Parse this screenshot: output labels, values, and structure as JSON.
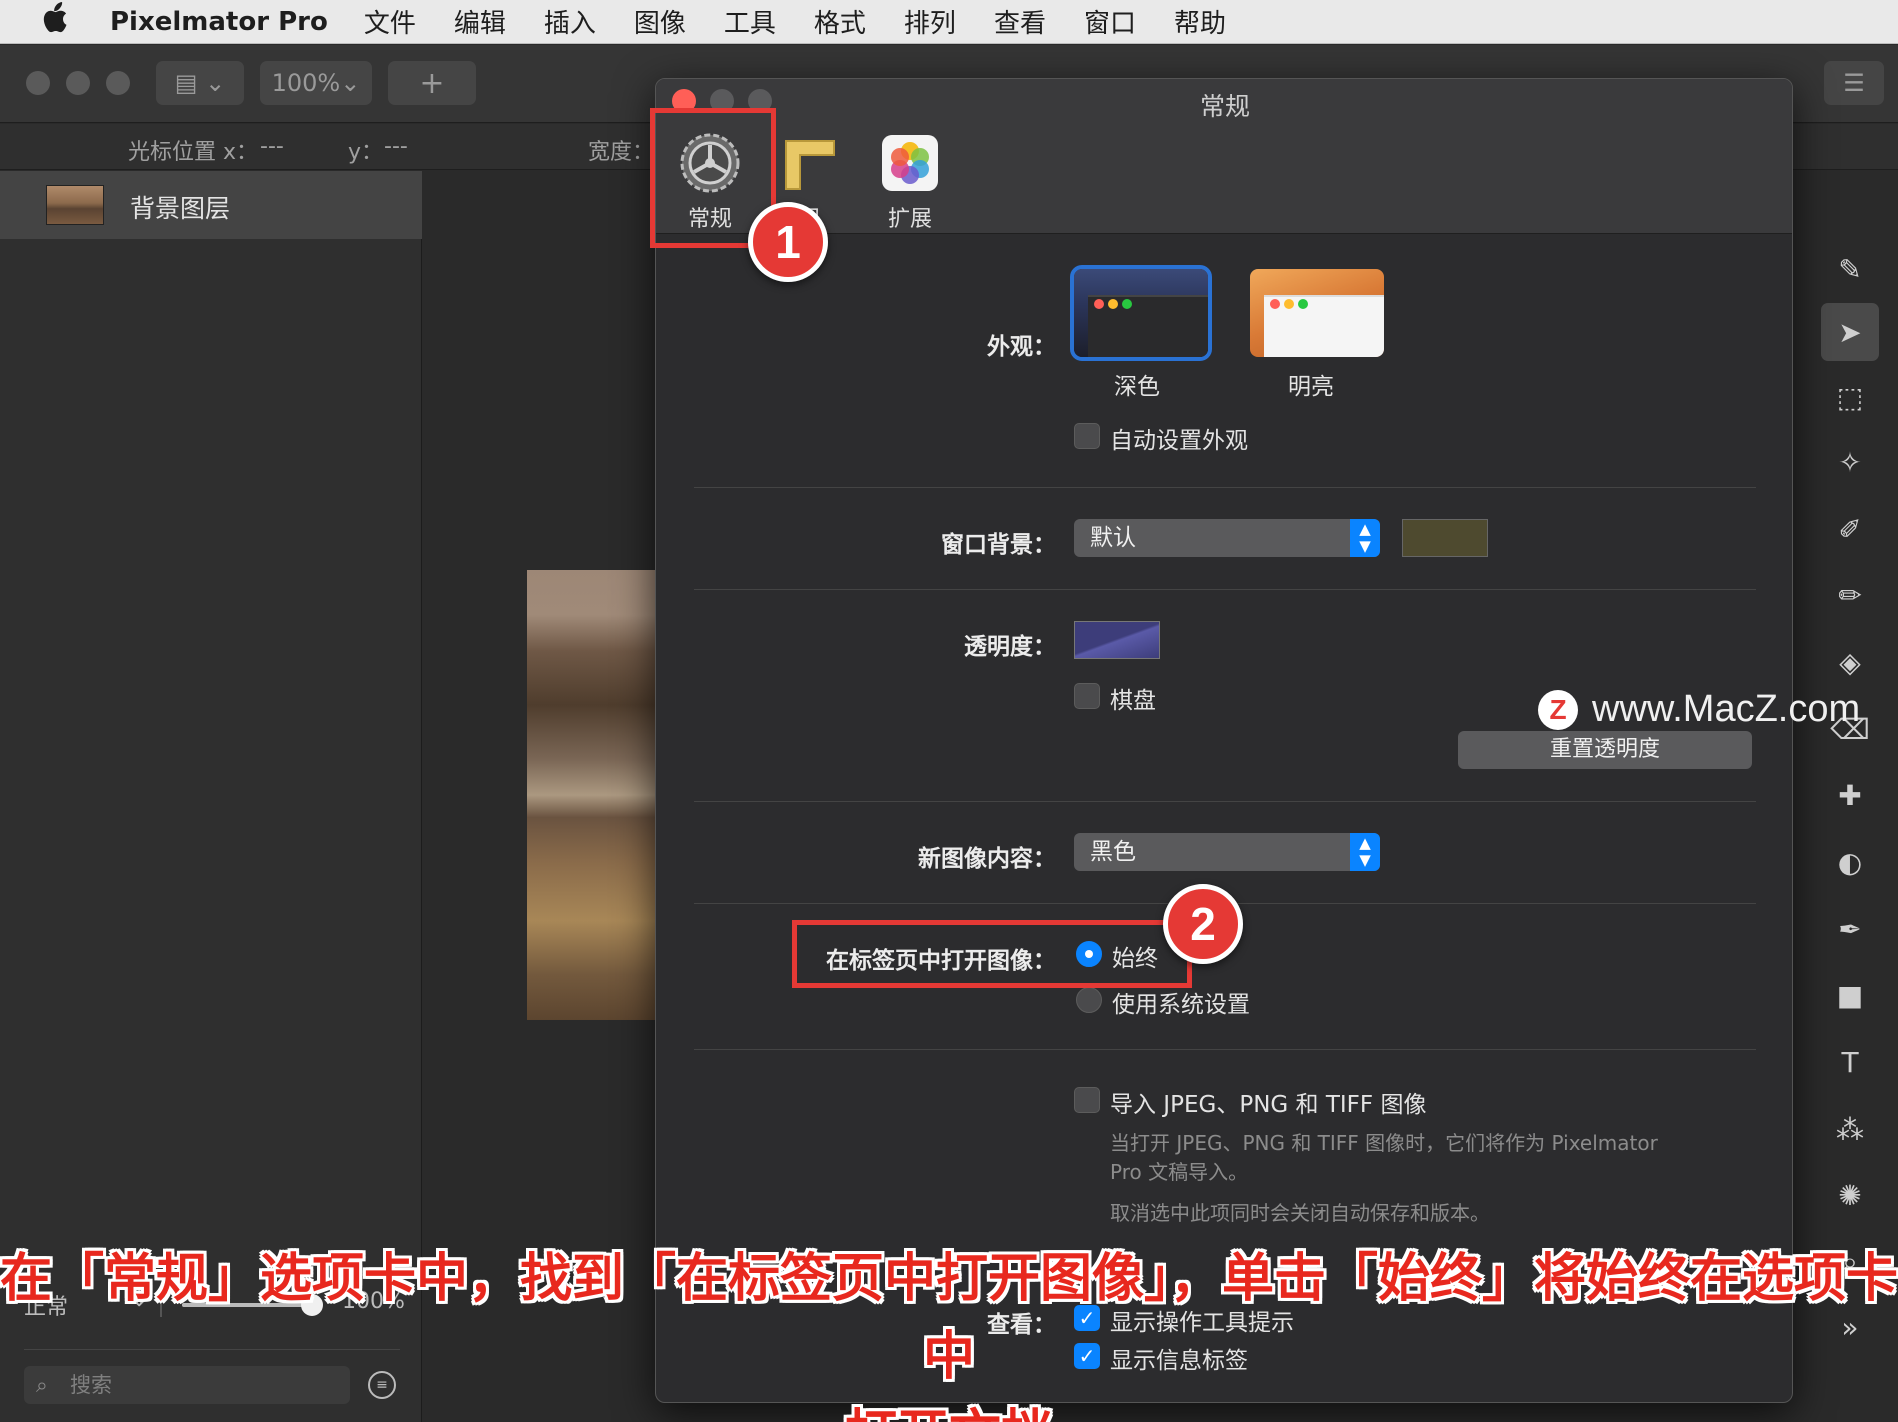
{
  "menubar": {
    "app_name": "Pixelmator Pro",
    "items": [
      "文件",
      "编辑",
      "插入",
      "图像",
      "工具",
      "格式",
      "排列",
      "查看",
      "窗口",
      "帮助"
    ]
  },
  "toolbar": {
    "zoom": "100%",
    "add_label": "+"
  },
  "infobar": {
    "cursor_x_label": "光标位置 x：",
    "cursor_x_value": "---",
    "cursor_y_label": "y：",
    "cursor_y_value": "---",
    "width_label": "宽度："
  },
  "layers": {
    "layer_name": "背景图层",
    "blend_mode": "正常",
    "opacity": "100%",
    "opacity_fraction": 1.0,
    "search_placeholder": "搜索"
  },
  "dialog": {
    "title": "常规",
    "tabs": [
      "常规",
      "尺",
      "扩展"
    ],
    "appearance_label": "外观：",
    "appearance_dark": "深色",
    "appearance_light": "明亮",
    "auto_appearance": "自动设置外观",
    "window_bg_label": "窗口背景：",
    "window_bg_value": "默认",
    "window_bg_swatch": "#4e4a2f",
    "transparency_label": "透明度：",
    "transparency_swatch": "#3d3d7a",
    "checkerboard": "棋盘",
    "reset_transparency": "重置透明度",
    "new_image_label": "新图像内容：",
    "new_image_value": "黑色",
    "open_in_tabs_label": "在标签页中打开图像：",
    "open_always": "始终",
    "open_system": "使用系统设置",
    "import_label": "导入 JPEG、PNG 和 TIFF 图像",
    "import_desc1": "当打开 JPEG、PNG 和 TIFF 图像时，它们将作为 Pixelmator",
    "import_desc2": "Pro 文稿导入。",
    "import_desc3": "取消选中此项同时会关闭自动保存和版本。",
    "view_label": "查看：",
    "show_tool_tips": "显示操作工具提示",
    "show_info_labels": "显示信息标签"
  },
  "annotations": {
    "badge1": "1",
    "badge2": "2",
    "caption_line1": "在「常规」选项卡中，找到「在标签页中打开图像」，单击「始终」将始终在选项卡中",
    "caption_line2": "打开文档",
    "watermark": "www.MacZ.com",
    "watermark_logo": "Z"
  }
}
